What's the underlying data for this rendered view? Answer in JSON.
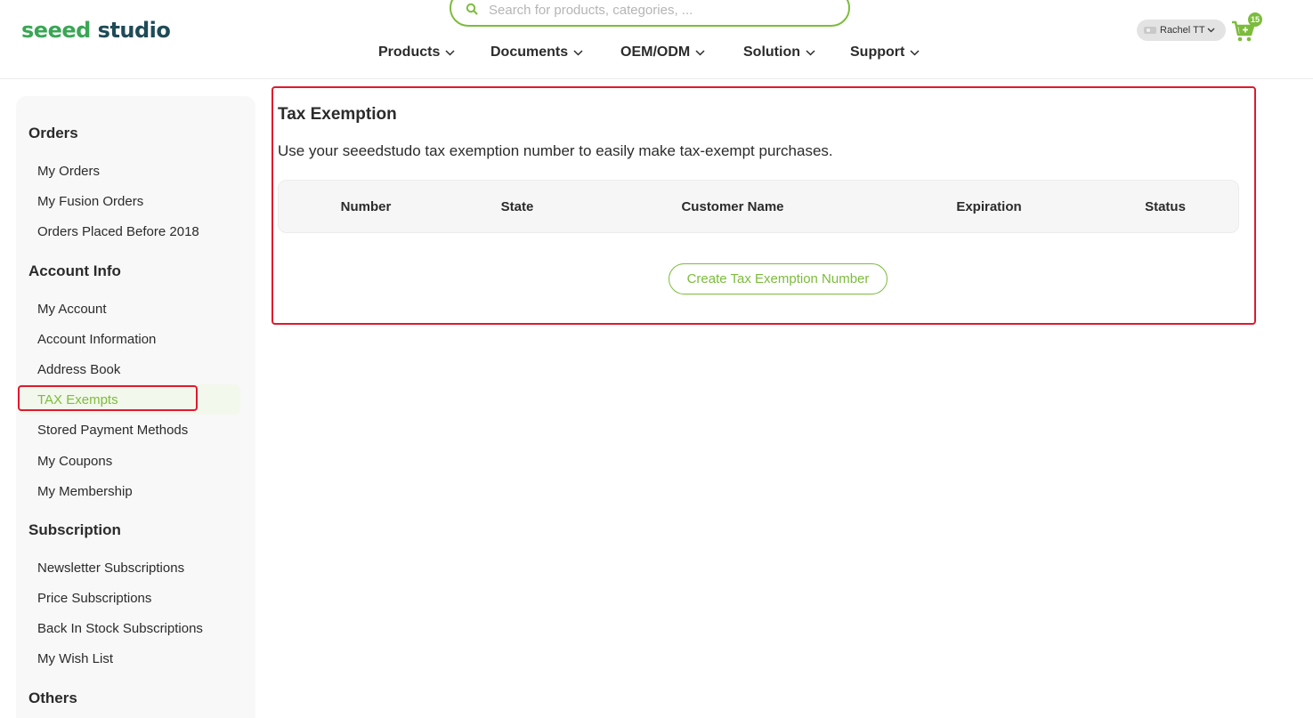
{
  "header": {
    "logo_part1": "seeed",
    "logo_part2": " studio",
    "search_placeholder": "Search for products, categories, ...",
    "nav": [
      {
        "label": "Products"
      },
      {
        "label": "Documents"
      },
      {
        "label": "OEM/ODM"
      },
      {
        "label": "Solution"
      },
      {
        "label": "Support"
      }
    ],
    "user_name": "Rachel TT",
    "cart_count": "15",
    "icons": {
      "search": "search-icon",
      "chevron": "chevron-down-icon",
      "cart": "cart-icon",
      "avatar": "avatar-icon"
    }
  },
  "sidebar": {
    "sections": [
      {
        "heading": "Orders",
        "items": [
          "My Orders",
          "My Fusion Orders",
          "Orders Placed Before 2018"
        ]
      },
      {
        "heading": "Account Info",
        "items": [
          "My Account",
          "Account Information",
          "Address Book",
          "TAX Exempts",
          "Stored Payment Methods",
          "My Coupons",
          "My Membership"
        ]
      },
      {
        "heading": "Subscription",
        "items": [
          "Newsletter Subscriptions",
          "Price Subscriptions",
          "Back In Stock Subscriptions",
          "My Wish List"
        ]
      },
      {
        "heading": "Others",
        "items": []
      }
    ],
    "active_item": "TAX Exempts"
  },
  "main": {
    "title": "Tax Exemption",
    "description": "Use your seeedstudo tax exemption number to easily make tax-exempt purchases.",
    "table_headers": [
      "Number",
      "State",
      "Customer Name",
      "Expiration",
      "Status"
    ],
    "create_button": "Create Tax Exemption Number"
  },
  "colors": {
    "accent": "#7cbc3c",
    "brand_green": "#3aa655",
    "brand_dark": "#1f4b57",
    "highlight": "#e0192d"
  }
}
